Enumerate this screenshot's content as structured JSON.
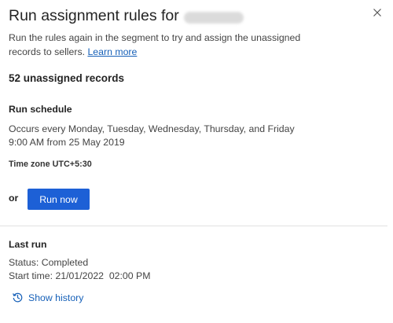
{
  "dialog": {
    "title": "Run assignment rules for",
    "redacted_name_hidden": true,
    "description": "Run the rules again in the segment to try and assign the unassigned records to sellers.",
    "learn_more": "Learn more",
    "close_icon": "close-icon"
  },
  "summary": {
    "unassigned": "52 unassigned records"
  },
  "schedule": {
    "heading": "Run schedule",
    "line1": "Occurs every Monday, Tuesday, Wednesday, Thursday, and Friday",
    "line2": "9:00 AM from 25 May 2019",
    "timezone": "Time zone UTC+5:30"
  },
  "actions": {
    "or_label": "or",
    "run_now": "Run now",
    "accent_color": "#1d60d6"
  },
  "last_run": {
    "heading": "Last run",
    "status": "Status: Completed",
    "start_time": "Start time: 21/01/2022  02:00 PM"
  },
  "history": {
    "label": "Show history",
    "icon": "history-icon",
    "link_color": "#1660b8"
  }
}
